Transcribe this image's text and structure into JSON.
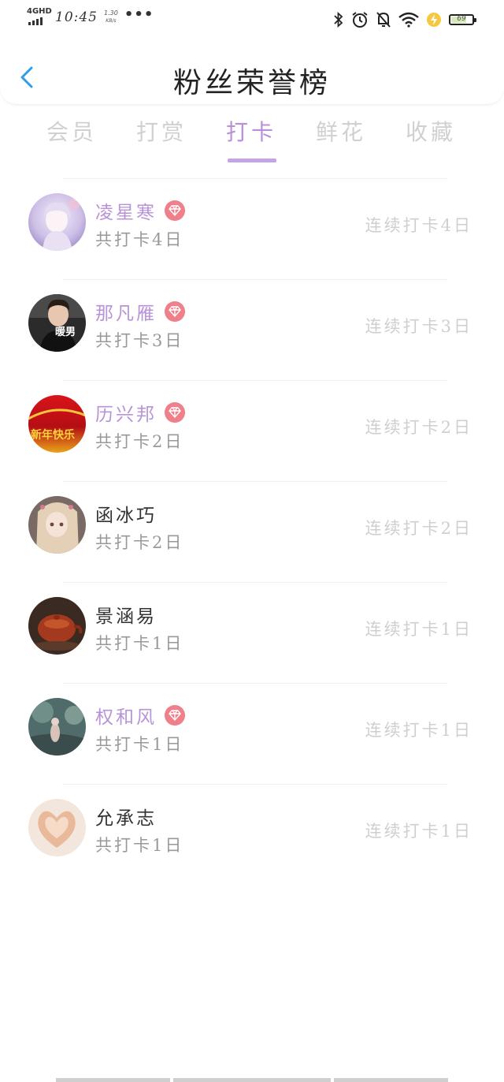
{
  "status_bar": {
    "network": "4GHD",
    "time": "10:45",
    "speed_value": "1.30",
    "speed_unit": "KB/s",
    "more": "•••",
    "battery": "69"
  },
  "header": {
    "title": "粉丝荣誉榜"
  },
  "tabs": [
    {
      "label": "会员",
      "active": false
    },
    {
      "label": "打赏",
      "active": false
    },
    {
      "label": "打卡",
      "active": true
    },
    {
      "label": "鲜花",
      "active": false
    },
    {
      "label": "收藏",
      "active": false
    }
  ],
  "rows": [
    {
      "name": "凌星寒",
      "vip": true,
      "total": "共打卡4日",
      "streak": "连续打卡4日"
    },
    {
      "name": "那凡雁",
      "vip": true,
      "total": "共打卡3日",
      "streak": "连续打卡3日"
    },
    {
      "name": "历兴邦",
      "vip": true,
      "total": "共打卡2日",
      "streak": "连续打卡2日"
    },
    {
      "name": "函冰巧",
      "vip": false,
      "total": "共打卡2日",
      "streak": "连续打卡2日"
    },
    {
      "name": "景涵易",
      "vip": false,
      "total": "共打卡1日",
      "streak": "连续打卡1日"
    },
    {
      "name": "权和风",
      "vip": true,
      "total": "共打卡1日",
      "streak": "连续打卡1日"
    },
    {
      "name": "允承志",
      "vip": false,
      "total": "共打卡1日",
      "streak": "连续打卡1日"
    }
  ],
  "avatar_2_caption": "暖男",
  "avatar_3_caption": "新年快乐",
  "colors": {
    "accent": "#b893d8",
    "vip_badge": "#ef7f8a",
    "back_arrow": "#2f9ee8"
  }
}
